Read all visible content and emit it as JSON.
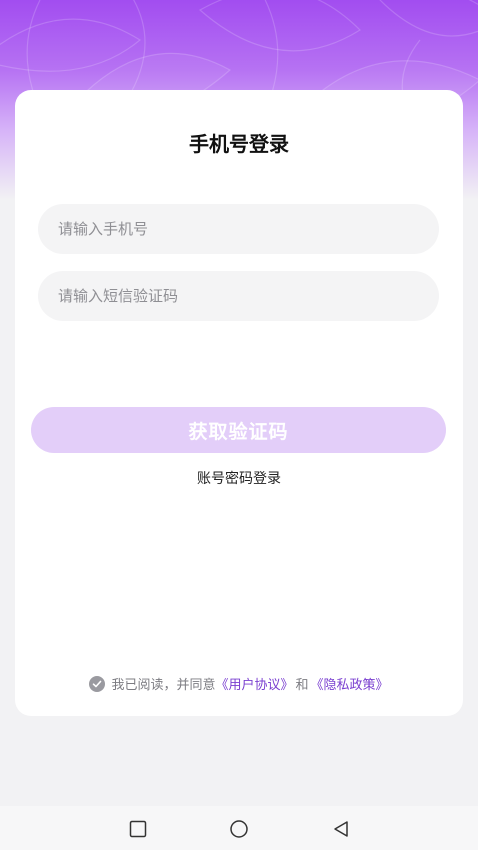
{
  "login": {
    "title": "手机号登录",
    "phone_placeholder": "请输入手机号",
    "code_placeholder": "请输入短信验证码",
    "get_code_label": "获取验证码",
    "password_login_label": "账号密码登录"
  },
  "agreement": {
    "prefix": "我已阅读，并同意",
    "user_agreement": "《用户协议》",
    "and": "和",
    "privacy_policy": "《隐私政策》"
  },
  "colors": {
    "accent": "#a24df0",
    "button_disabled": "#e3cef9",
    "link": "#7a3fd0"
  },
  "icons": {
    "agree_check": "check-circle-icon",
    "nav_recent": "square-icon",
    "nav_home": "circle-icon",
    "nav_back": "triangle-back-icon"
  }
}
